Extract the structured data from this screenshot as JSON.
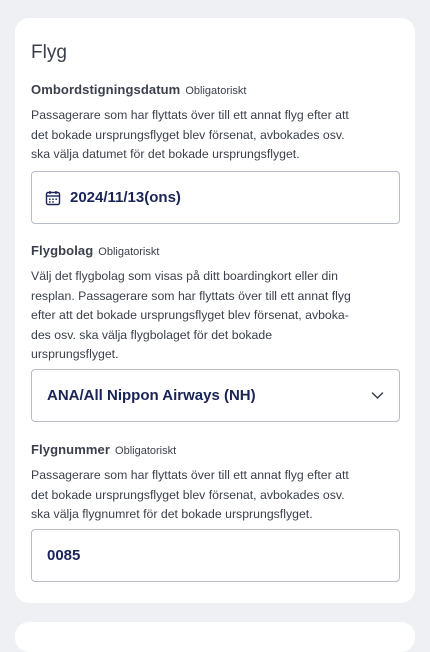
{
  "section": {
    "title": "Flyg"
  },
  "boarding_date": {
    "label": "Ombordstigningsdatum",
    "required": "Obligatoriskt",
    "help_lines": [
      "Passagerare som har flyttats över till ett annat flyg efter att",
      "det bokade ursprungsflyget blev försenat, avbokades osv.",
      "ska välja datumet för det bokade ursprungsflyget."
    ],
    "value": "2024/11/13(ons)",
    "icon": "calendar-icon"
  },
  "airline": {
    "label": "Flygbolag",
    "required": "Obligatoriskt",
    "help_lines": [
      "Välj det flygbolag som visas på ditt boardingkort eller din",
      "resplan. Passagerare som har flyttats över till ett annat flyg",
      "efter att det bokade ursprungsflyget blev försenat, avboka-",
      "des osv. ska välja flygbolaget för det bokade",
      "ursprungsflyget."
    ],
    "selected": "ANA/All Nippon Airways (NH)",
    "icon": "chevron-down-icon"
  },
  "flight_number": {
    "label": "Flygnummer",
    "required": "Obligatoriskt",
    "help_lines": [
      "Passagerare som har flyttats över till ett annat flyg efter att",
      "det bokade ursprungsflyget blev försenat, avbokades osv.",
      "ska välja flygnumret för det bokade ursprungsflyget."
    ],
    "value": "0085"
  },
  "colors": {
    "page_bg": "#eef0f4",
    "card_bg": "#ffffff",
    "text": "#3a3f4b",
    "value_text": "#1a2456",
    "border": "#b8bcc6"
  }
}
